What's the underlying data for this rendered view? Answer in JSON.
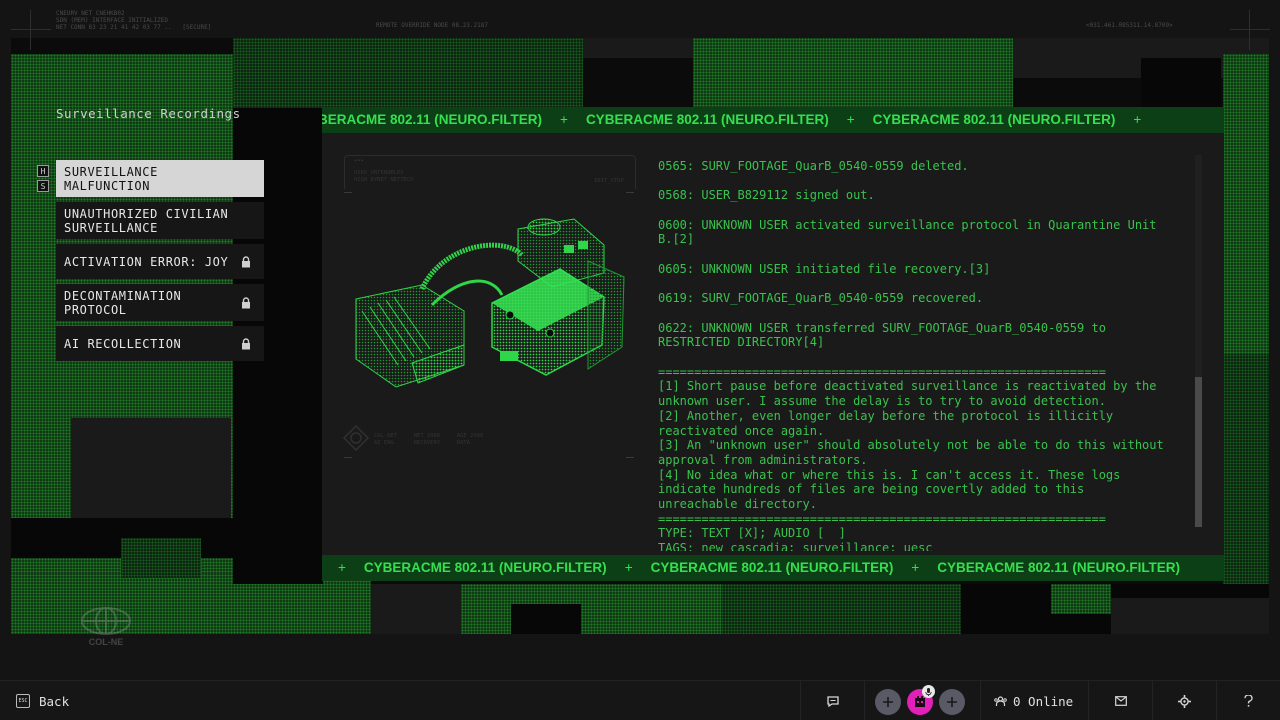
{
  "top_meta": {
    "left": "CNEURV NET CNEHKB02\nSDN (MEM) INTERFACE INITIALIZED\nNET CONN 83 23 21 41 42 03 77 ..   [SECURE]",
    "center": "REMOTE OVERRIDE NODE 08.23.2187",
    "right": "<031.461.085311.14.8709>"
  },
  "sidebar": {
    "title": "Surveillance Recordings",
    "keys": [
      "H",
      "S"
    ],
    "items": [
      {
        "label": "SURVEILLANCE MALFUNCTION",
        "locked": false,
        "active": true
      },
      {
        "label": "UNAUTHORIZED CIVILIAN SURVEILLANCE",
        "locked": false,
        "active": false
      },
      {
        "label": "ACTIVATION ERROR: JOY",
        "locked": true,
        "active": false
      },
      {
        "label": "DECONTAMINATION PROTOCOL",
        "locked": true,
        "active": false
      },
      {
        "label": "AI RECOLLECTION",
        "locked": true,
        "active": false
      }
    ]
  },
  "ticker": {
    "text": "CYBERACME 802.11 (NEURO.FILTER)",
    "separator": "+"
  },
  "device_frame": {
    "header": "USER_UNTENABLED\nHIGH BYNET NETTECH",
    "header_right": "INIT_STOP",
    "footer": "COL-NET     NET 2066     AGE 2088\nAI ENG      RECOVERY     DATA"
  },
  "log": {
    "entries": [
      "0565: SURV_FOOTAGE_QuarB_0540-0559 deleted.",
      "0568: USER_B829112 signed out.",
      "0600: UNKNOWN USER activated surveillance protocol in Quarantine Unit B.[2]",
      "0605: UNKNOWN USER initiated file recovery.[3]",
      "0619: SURV_FOOTAGE_QuarB_0540-0559 recovered.",
      "0622: UNKNOWN USER transferred SURV_FOOTAGE_QuarB_0540-0559 to RESTRICTED DIRECTORY[4]"
    ],
    "divider": "==============================================================",
    "notes": [
      "[1] Short pause before deactivated surveillance is reactivated by the unknown user. I assume the delay is to try to avoid detection.",
      "[2] Another, even longer delay before the protocol is illicitly reactivated once again.",
      "[3] An \"unknown user\" should absolutely not be able to do this without approval from administrators.",
      "[4] No idea what or where this is. I can't access it. These logs indicate hundreds of files are being covertly added to this unreachable directory."
    ],
    "type_line": "TYPE: TEXT [X]; AUDIO [  ]",
    "tags_line": "TAGS: new cascadia; surveillance; uesc"
  },
  "logo_text": "COL-NE",
  "footer": {
    "esc_label": "ESC",
    "back_label": "Back",
    "online_text": "0 Online"
  },
  "colors": {
    "accent_green": "#39c24d",
    "ticker_bg": "#0d3f16",
    "avatar_pink": "#e020b8"
  },
  "icons": [
    "lock-icon",
    "chat-icon",
    "plus-icon",
    "avatar-icon",
    "microphone-icon",
    "users-icon",
    "mail-icon",
    "gear-icon",
    "help-icon",
    "esc-key-icon"
  ]
}
